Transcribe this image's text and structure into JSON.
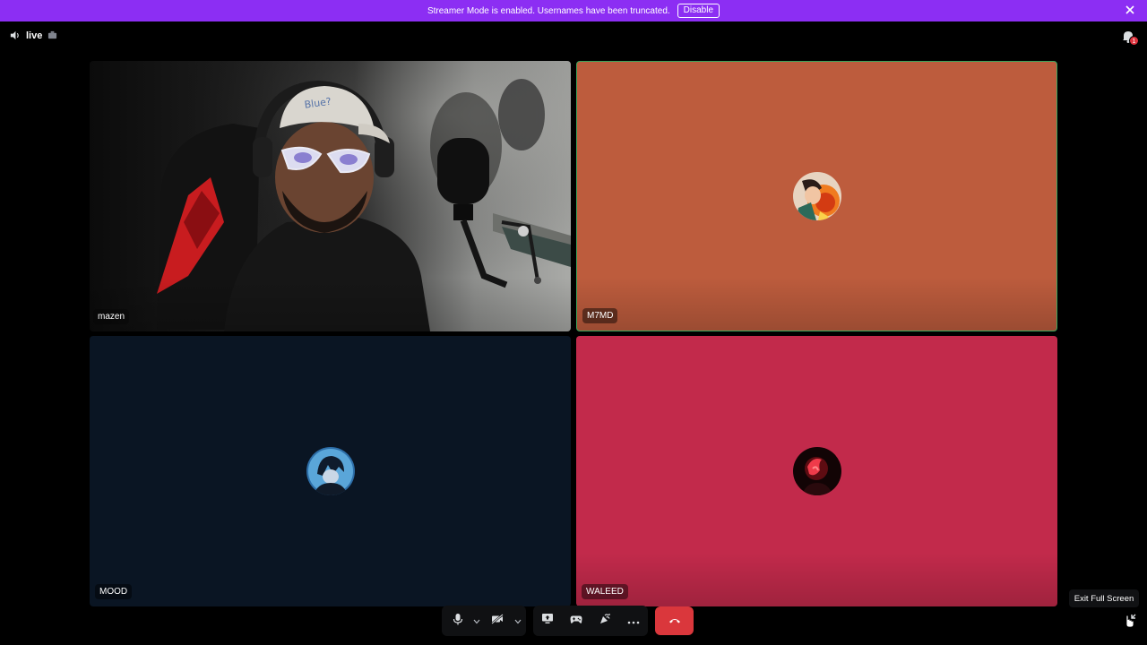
{
  "banner": {
    "message": "Streamer Mode is enabled. Usernames have been truncated.",
    "disable_label": "Disable",
    "close_icon": "close-icon",
    "color": "#8c2ef3"
  },
  "channel": {
    "icon": "speaker-icon",
    "name": "live",
    "status_icon": "stream-icon"
  },
  "inbox": {
    "icon": "inbox-icon",
    "badge_count": "1"
  },
  "participants": [
    {
      "name": "mazen",
      "video": true,
      "tile_color": "#070707"
    },
    {
      "name": "M7MD",
      "video": false,
      "speaking": true,
      "tile_color": "#bd5c3d"
    },
    {
      "name": "MOOD",
      "video": false,
      "tile_color": "#0a1523"
    },
    {
      "name": "WALEED",
      "video": false,
      "tile_color": "#c22a4b"
    }
  ],
  "controls": {
    "mic_icon": "microphone-icon",
    "camera_icon": "camera-off-icon",
    "screen_share_icon": "screen-share-icon",
    "activity_icon": "gamepad-icon",
    "soundboard_icon": "soundboard-icon",
    "more_icon": "more-icon",
    "end_call_icon": "hang-up-icon",
    "end_call_color": "#da373c"
  },
  "tooltip": {
    "text": "Exit Full Screen"
  },
  "fullscreen_icon": "exit-fullscreen-icon"
}
